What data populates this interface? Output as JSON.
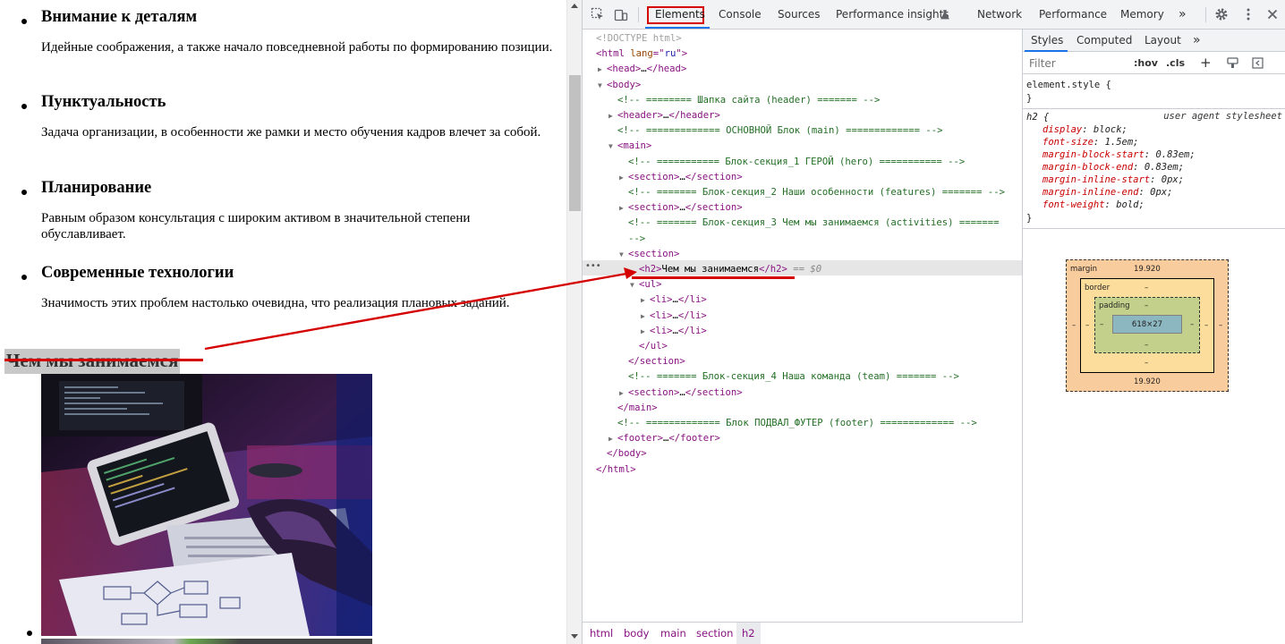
{
  "page": {
    "features": [
      {
        "title": "Внимание к деталям",
        "text": "Идейные соображения, а также начало повседневной работы по формированию позиции."
      },
      {
        "title": "Пунктуальность",
        "text": "Задача организации, в особенности же рамки и место обучения кадров влечет за собой."
      },
      {
        "title": "Планирование",
        "text": "Равным образом консультация с широким активом в значительной степени обуславливает."
      },
      {
        "title": "Современные технологии",
        "text": "Значимость этих проблем настолько очевидна, что реализация плановых заданий."
      }
    ],
    "activities_heading": "Чем мы занимаемся"
  },
  "devtools": {
    "tabs": [
      "Elements",
      "Console",
      "Sources",
      "Performance insights",
      "Network",
      "Performance",
      "Memory"
    ],
    "more_tabs": "»",
    "dom": [
      {
        "indent": 0,
        "arrow": "",
        "parts": [
          [
            "doc",
            "<!DOCTYPE html>"
          ]
        ]
      },
      {
        "indent": 0,
        "arrow": "",
        "parts": [
          [
            "tag",
            "<html "
          ],
          [
            "attr",
            "lang"
          ],
          [
            "tag",
            "=\""
          ],
          [
            "val",
            "ru"
          ],
          [
            "tag",
            "\">"
          ]
        ]
      },
      {
        "indent": 1,
        "arrow": "▶",
        "parts": [
          [
            "tag",
            "<head>"
          ],
          [
            "txt",
            "…"
          ],
          [
            "tag",
            "</head>"
          ]
        ]
      },
      {
        "indent": 1,
        "arrow": "▼",
        "parts": [
          [
            "tag",
            "<body>"
          ]
        ]
      },
      {
        "indent": 2,
        "arrow": "",
        "parts": [
          [
            "cmt",
            "<!-- ======== Шапка сайта (header) ======= -->"
          ]
        ]
      },
      {
        "indent": 2,
        "arrow": "▶",
        "parts": [
          [
            "tag",
            "<header>"
          ],
          [
            "txt",
            "…"
          ],
          [
            "tag",
            "</header>"
          ]
        ]
      },
      {
        "indent": 2,
        "arrow": "",
        "parts": [
          [
            "cmt",
            "<!-- ============= ОСНОВНОЙ Блок (main) ============= -->"
          ]
        ]
      },
      {
        "indent": 2,
        "arrow": "▼",
        "parts": [
          [
            "tag",
            "<main>"
          ]
        ]
      },
      {
        "indent": 3,
        "arrow": "",
        "parts": [
          [
            "cmt",
            "<!-- =========== Блок-секция_1 ГЕРОЙ (hero) =========== -->"
          ]
        ]
      },
      {
        "indent": 3,
        "arrow": "▶",
        "parts": [
          [
            "tag",
            "<section>"
          ],
          [
            "txt",
            "…"
          ],
          [
            "tag",
            "</section>"
          ]
        ]
      },
      {
        "indent": 3,
        "arrow": "",
        "parts": [
          [
            "cmt",
            "<!-- ======= Блок-секция_2 Наши особенности (features) ======= -->"
          ]
        ]
      },
      {
        "indent": 3,
        "arrow": "▶",
        "parts": [
          [
            "tag",
            "<section>"
          ],
          [
            "txt",
            "…"
          ],
          [
            "tag",
            "</section>"
          ]
        ]
      },
      {
        "indent": 3,
        "arrow": "",
        "parts": [
          [
            "cmt",
            "<!-- ======= Блок-секция_3 Чем мы занимаемся (activities) ======="
          ]
        ]
      },
      {
        "indent": 3,
        "arrow": "",
        "parts": [
          [
            "cmt",
            "-->"
          ]
        ]
      },
      {
        "indent": 3,
        "arrow": "▼",
        "parts": [
          [
            "tag",
            "<section>"
          ]
        ]
      },
      {
        "indent": 4,
        "arrow": "",
        "parts": [
          [
            "tag",
            "<h2>"
          ],
          [
            "txt",
            "Чем мы занимаемся"
          ],
          [
            "tag",
            "</h2>"
          ],
          [
            "eq",
            " == $0"
          ]
        ]
      },
      {
        "indent": 4,
        "arrow": "▼",
        "parts": [
          [
            "tag",
            "<ul>"
          ]
        ]
      },
      {
        "indent": 5,
        "arrow": "▶",
        "parts": [
          [
            "tag",
            "<li>"
          ],
          [
            "txt",
            "…"
          ],
          [
            "tag",
            "</li>"
          ]
        ]
      },
      {
        "indent": 5,
        "arrow": "▶",
        "parts": [
          [
            "tag",
            "<li>"
          ],
          [
            "txt",
            "…"
          ],
          [
            "tag",
            "</li>"
          ]
        ]
      },
      {
        "indent": 5,
        "arrow": "▶",
        "parts": [
          [
            "tag",
            "<li>"
          ],
          [
            "txt",
            "…"
          ],
          [
            "tag",
            "</li>"
          ]
        ]
      },
      {
        "indent": 4,
        "arrow": "",
        "parts": [
          [
            "tag",
            "</ul>"
          ]
        ]
      },
      {
        "indent": 3,
        "arrow": "",
        "parts": [
          [
            "tag",
            "</section>"
          ]
        ]
      },
      {
        "indent": 3,
        "arrow": "",
        "parts": [
          [
            "cmt",
            "<!-- ======= Блок-секция_4 Наша команда (team) ======= -->"
          ]
        ]
      },
      {
        "indent": 3,
        "arrow": "▶",
        "parts": [
          [
            "tag",
            "<section>"
          ],
          [
            "txt",
            "…"
          ],
          [
            "tag",
            "</section>"
          ]
        ]
      },
      {
        "indent": 2,
        "arrow": "",
        "parts": [
          [
            "tag",
            "</main>"
          ]
        ]
      },
      {
        "indent": 2,
        "arrow": "",
        "parts": [
          [
            "cmt",
            "<!-- ============= Блок ПОДВАЛ_ФУТЕР  (footer) ============= -->"
          ]
        ]
      },
      {
        "indent": 2,
        "arrow": "▶",
        "parts": [
          [
            "tag",
            "<footer>"
          ],
          [
            "txt",
            "…"
          ],
          [
            "tag",
            "</footer>"
          ]
        ]
      },
      {
        "indent": 1,
        "arrow": "",
        "parts": [
          [
            "tag",
            "</body>"
          ]
        ]
      },
      {
        "indent": 0,
        "arrow": "",
        "parts": [
          [
            "tag",
            "</html>"
          ]
        ]
      }
    ],
    "selected_dots": "•••",
    "breadcrumbs": [
      "html",
      "body",
      "main",
      "section",
      "h2"
    ],
    "styles_tabs": [
      "Styles",
      "Computed",
      "Layout"
    ],
    "styles_more": "»",
    "filter_placeholder": "Filter",
    "hov_label": ":hov",
    "cls_label": ".cls",
    "plus_label": "+",
    "element_style": "element.style {",
    "close_brace": "}",
    "rule_selector": "h2 {",
    "ua_label": "user agent stylesheet",
    "declarations": [
      {
        "prop": "display",
        "value": "block;"
      },
      {
        "prop": "font-size",
        "value": "1.5em;"
      },
      {
        "prop": "margin-block-start",
        "value": "0.83em;"
      },
      {
        "prop": "margin-block-end",
        "value": "0.83em;"
      },
      {
        "prop": "margin-inline-start",
        "value": "0px;"
      },
      {
        "prop": "margin-inline-end",
        "value": "0px;"
      },
      {
        "prop": "font-weight",
        "value": "bold;"
      }
    ],
    "box_model": {
      "margin_label": "margin",
      "margin_top": "19.920",
      "margin_bottom": "19.920",
      "margin_left": "–",
      "margin_right": "–",
      "border_label": "border",
      "border_top": "–",
      "border_bottom": "–",
      "border_left": "–",
      "border_right": "–",
      "padding_label": "padding",
      "padding_top": "–",
      "padding_bottom": "–",
      "padding_left": "–",
      "padding_right": "–",
      "content_size": "618×27"
    }
  }
}
